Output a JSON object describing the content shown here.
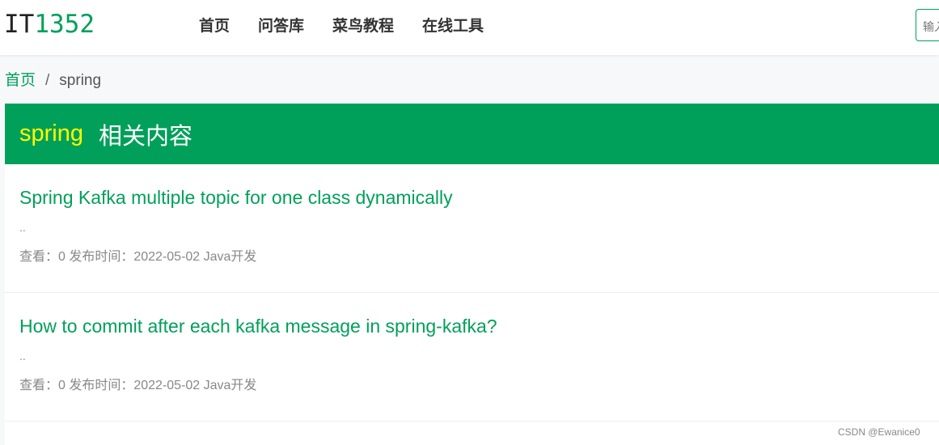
{
  "header": {
    "logo_it": "IT",
    "logo_num": "1352",
    "nav": [
      "首页",
      "问答库",
      "菜鸟教程",
      "在线工具"
    ],
    "search_placeholder": "输入"
  },
  "breadcrumb": {
    "home": "首页",
    "separator": "/",
    "current": "spring"
  },
  "panel": {
    "keyword": "spring",
    "suffix": "相关内容",
    "items": [
      {
        "title": "Spring Kafka multiple topic for one class dynamically",
        "excerpt": "..",
        "meta": "查看：0 发布时间：2022-05-02 Java开发"
      },
      {
        "title": "How to commit after each kafka message in spring-kafka?",
        "excerpt": "..",
        "meta": "查看：0 发布时间：2022-05-02 Java开发"
      }
    ]
  },
  "watermark": "CSDN @Ewanice0",
  "colors": {
    "brand": "#00a05a",
    "keyword": "#ffff00"
  }
}
